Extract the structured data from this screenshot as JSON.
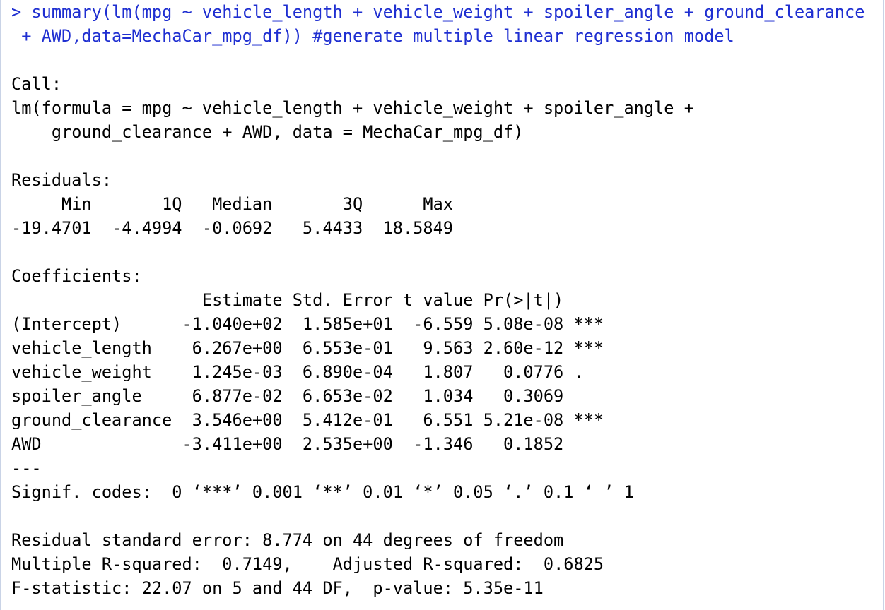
{
  "colors": {
    "command": "#1f2fd1",
    "output": "#000000",
    "background": "#ffffff"
  },
  "input": {
    "lines": [
      "> summary(lm(mpg ~ vehicle_length + vehicle_weight + spoiler_angle + ground_clearance",
      " + AWD,data=MechaCar_mpg_df)) #generate multiple linear regression model"
    ]
  },
  "output": {
    "call": {
      "heading": "Call:",
      "lines": [
        "lm(formula = mpg ~ vehicle_length + vehicle_weight + spoiler_angle + ",
        "    ground_clearance + AWD, data = MechaCar_mpg_df)"
      ]
    },
    "residuals": {
      "heading": "Residuals:",
      "header_line": "     Min       1Q   Median       3Q      Max ",
      "values_line": "-19.4701  -4.4994  -0.0692   5.4433  18.5849 "
    },
    "coefficients": {
      "heading": "Coefficients:",
      "header_line": "                   Estimate Std. Error t value Pr(>|t|)    ",
      "rows": [
        "(Intercept)      -1.040e+02  1.585e+01  -6.559 5.08e-08 ***",
        "vehicle_length    6.267e+00  6.553e-01   9.563 2.60e-12 ***",
        "vehicle_weight    1.245e-03  6.890e-04   1.807   0.0776 .  ",
        "spoiler_angle     6.877e-02  6.653e-02   1.034   0.3069    ",
        "ground_clearance  3.546e+00  5.412e-01   6.551 5.21e-08 ***",
        "AWD              -3.411e+00  2.535e+00  -1.346   0.1852    "
      ],
      "separator": "---",
      "signif_codes": "Signif. codes:  0 ‘***’ 0.001 ‘**’ 0.01 ‘*’ 0.05 ‘.’ 0.1 ‘ ’ 1"
    },
    "fit": {
      "residual_standard_error": "Residual standard error: 8.774 on 44 degrees of freedom",
      "r_squared": "Multiple R-squared:  0.7149,\tAdjusted R-squared:  0.6825 ",
      "f_statistic": "F-statistic: 22.07 on 5 and 44 DF,  p-value: 5.35e-11"
    }
  }
}
